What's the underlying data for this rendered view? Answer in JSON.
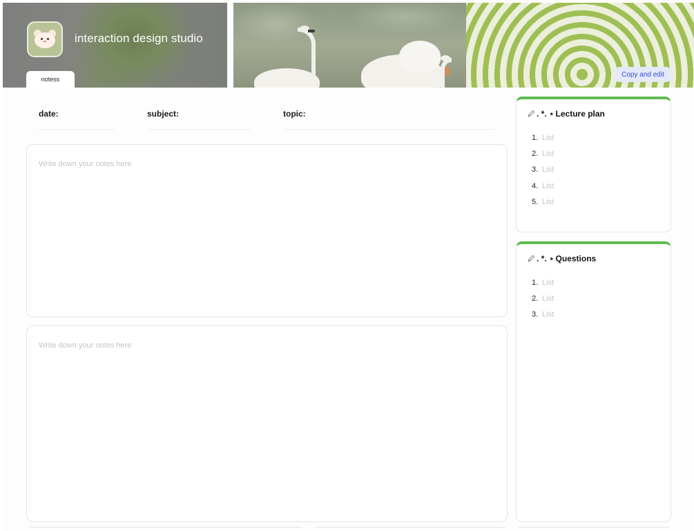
{
  "header": {
    "site_title": "interaction design studio",
    "tab_label": "notess",
    "copy_edit_label": "Copy and edit"
  },
  "fields": {
    "date_label": "date:",
    "subject_label": "subject:",
    "topic_label": "topic:"
  },
  "notes": [
    {
      "placeholder": "Write down your notes here",
      "value": ""
    },
    {
      "placeholder": "Write down your notes here",
      "value": ""
    }
  ],
  "lecture_plan": {
    "prefix": ". *. ⋆",
    "title": "Lecture plan",
    "items": [
      {
        "num": "1.",
        "text": "List"
      },
      {
        "num": "2.",
        "text": "List"
      },
      {
        "num": "3.",
        "text": "List"
      },
      {
        "num": "4.",
        "text": "List"
      },
      {
        "num": "5.",
        "text": "List"
      }
    ]
  },
  "questions": {
    "prefix": ". *. ⋆",
    "title": "Questions",
    "items": [
      {
        "num": "1.",
        "text": "List"
      },
      {
        "num": "2.",
        "text": "List"
      },
      {
        "num": "3.",
        "text": "List"
      }
    ]
  },
  "colors": {
    "card_accent": "#5dbb4f",
    "copy_edit_bg": "#e4e9fb",
    "copy_edit_text": "#3152d6"
  }
}
